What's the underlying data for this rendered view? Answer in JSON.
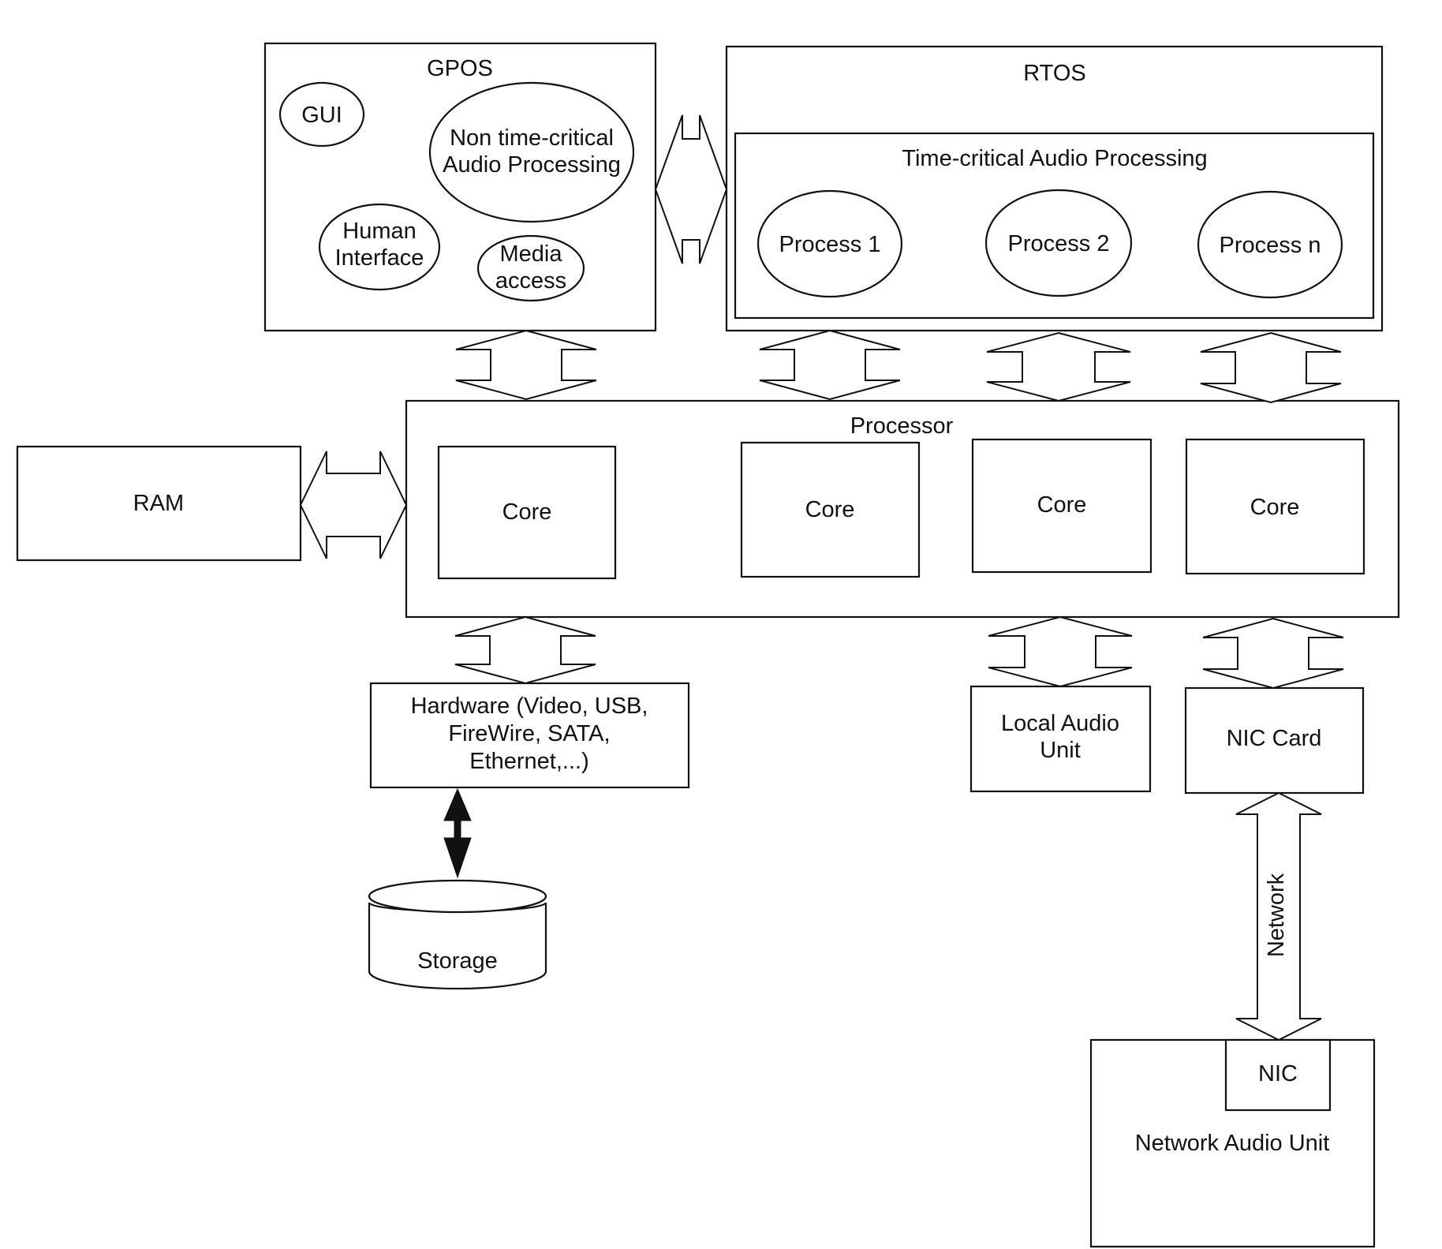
{
  "diagram": {
    "gpos": {
      "title": "GPOS",
      "items": [
        {
          "label_lines": [
            "GUI"
          ]
        },
        {
          "label_lines": [
            "Non time-critical",
            "Audio Processing"
          ]
        },
        {
          "label_lines": [
            "Human",
            "Interface"
          ]
        },
        {
          "label_lines": [
            "Media",
            "access"
          ]
        }
      ]
    },
    "rtos": {
      "title": "RTOS",
      "time_critical": {
        "title": "Time-critical Audio Processing",
        "processes": [
          "Process 1",
          "Process 2",
          "Process n"
        ]
      }
    },
    "processor": {
      "title": "Processor",
      "cores": [
        "Core",
        "Core",
        "Core",
        "Core"
      ]
    },
    "ram": {
      "label": "RAM"
    },
    "hardware": {
      "label_lines": [
        "Hardware (Video, USB,",
        "FireWire, SATA,",
        "Ethernet,...)"
      ]
    },
    "storage": {
      "label": "Storage"
    },
    "local_audio_unit": {
      "label_lines": [
        "Local Audio",
        "Unit"
      ]
    },
    "nic_card": {
      "label": "NIC Card"
    },
    "network_link": {
      "label": "Network"
    },
    "network_audio_unit": {
      "label": "Network Audio Unit",
      "nic_label": "NIC"
    },
    "colors": {
      "line": "#111111",
      "background": "#ffffff"
    }
  }
}
